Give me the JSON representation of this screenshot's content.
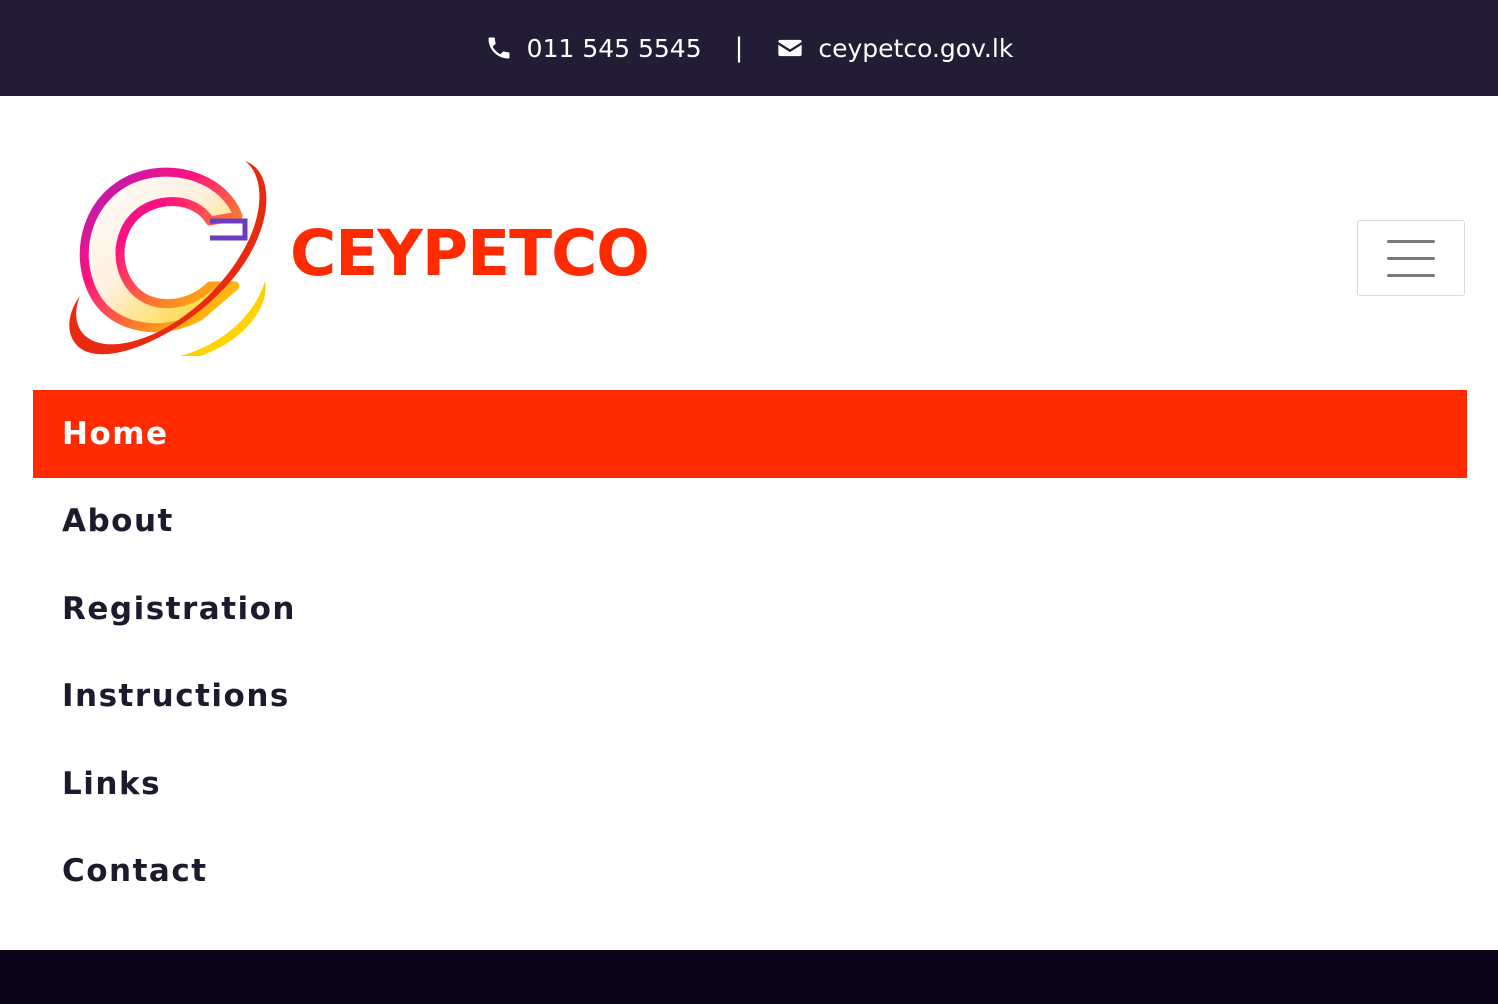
{
  "topbar": {
    "phone": "011 545 5545",
    "separator": "|",
    "email": "ceypetco.gov.lk",
    "phone_icon": "phone-icon",
    "email_icon": "envelope-icon"
  },
  "brand": {
    "name": "CEYPETCO",
    "logo_icon": "ceypetco-logo",
    "color": "#ff2a00"
  },
  "menu_toggle": {
    "icon": "hamburger-icon"
  },
  "nav": {
    "items": [
      {
        "label": "Home",
        "active": true
      },
      {
        "label": "About",
        "active": false
      },
      {
        "label": "Registration",
        "active": false
      },
      {
        "label": "Instructions",
        "active": false
      },
      {
        "label": "Links",
        "active": false
      },
      {
        "label": "Contact",
        "active": false
      }
    ]
  },
  "colors": {
    "topbar_bg": "#221c35",
    "accent": "#ff2a00",
    "footer_bg": "#0b0316",
    "nav_text": "#1e1a2e"
  }
}
